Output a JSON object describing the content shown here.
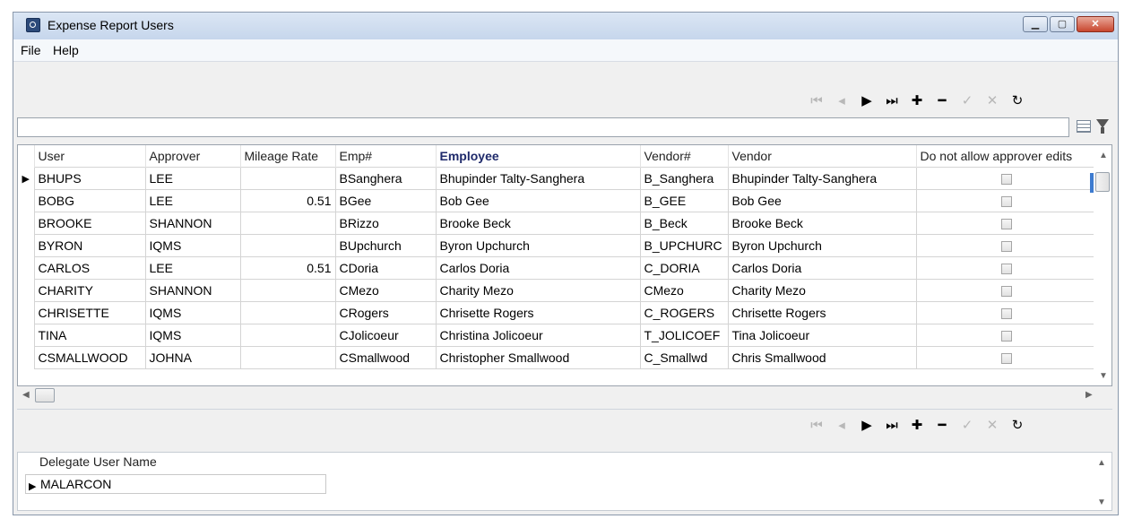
{
  "window": {
    "title": "Expense Report Users"
  },
  "menu": {
    "file": "File",
    "help": "Help"
  },
  "toolbar": {
    "first": "⏮",
    "prior": "◂",
    "next": "▶",
    "last": "⏭",
    "insert": "✚",
    "delete": "━",
    "post": "✓",
    "cancel": "✕",
    "refresh": "↻"
  },
  "grid": {
    "columns": [
      "User",
      "Approver",
      "Mileage Rate",
      "Emp#",
      "Employee",
      "Vendor#",
      "Vendor",
      "Do not allow approver edits"
    ],
    "rows": [
      [
        "BHUPS",
        "LEE",
        "",
        "BSanghera",
        "Bhupinder Talty-Sanghera",
        "B_Sanghera",
        "Bhupinder Talty-Sanghera"
      ],
      [
        "BOBG",
        "LEE",
        "0.51",
        "BGee",
        "Bob Gee",
        "B_GEE",
        "Bob Gee"
      ],
      [
        "BROOKE",
        "SHANNON",
        "",
        "BRizzo",
        "Brooke Beck",
        "B_Beck",
        "Brooke Beck"
      ],
      [
        "BYRON",
        "IQMS",
        "",
        "BUpchurch",
        "Byron Upchurch",
        "B_UPCHURC",
        "Byron Upchurch"
      ],
      [
        "CARLOS",
        "LEE",
        "0.51",
        "CDoria",
        "Carlos Doria",
        "C_DORIA",
        "Carlos Doria"
      ],
      [
        "CHARITY",
        "SHANNON",
        "",
        "CMezo",
        "Charity Mezo",
        "CMezo",
        "Charity Mezo"
      ],
      [
        "CHRISETTE",
        "IQMS",
        "",
        "CRogers",
        "Chrisette Rogers",
        "C_ROGERS",
        "Chrisette Rogers"
      ],
      [
        "TINA",
        "IQMS",
        "",
        "CJolicoeur",
        "Christina Jolicoeur",
        "T_JOLICOEF",
        "Tina Jolicoeur"
      ],
      [
        "CSMALLWOOD",
        "JOHNA",
        "",
        "CSmallwood",
        "Christopher Smallwood",
        "C_Smallwd",
        "Chris Smallwood"
      ]
    ]
  },
  "delegate": {
    "header": "Delegate User Name",
    "value": "MALARCON"
  }
}
